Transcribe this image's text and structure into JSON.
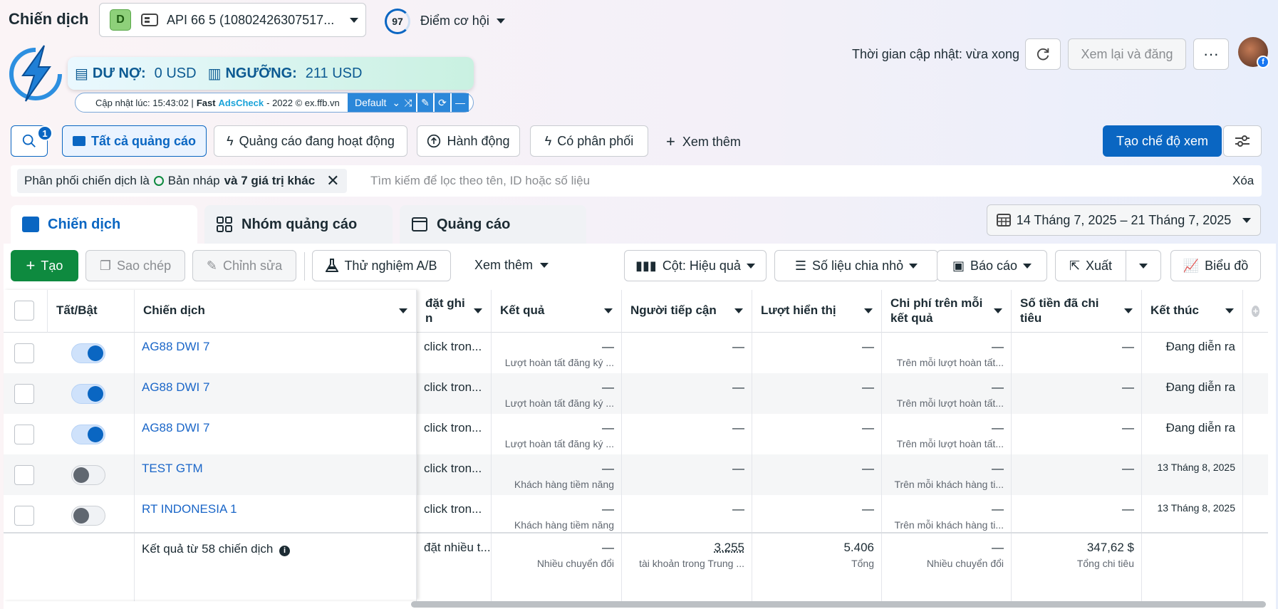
{
  "header": {
    "title": "Chiến dịch",
    "account_letter": "D",
    "account_name": "API 66 5 (10802426307517...",
    "opportunity_score": "97",
    "opportunity_label": "Điểm cơ hội",
    "update_time": "Thời gian cập nhật: vừa xong",
    "review_publish": "Xem lại và đăng",
    "more": "···"
  },
  "extension": {
    "debt_label": "DƯ NỢ:",
    "debt_value": "0 USD",
    "threshold_label": "NGƯỠNG:",
    "threshold_value": "211 USD",
    "updated_at": "Cập nhật lúc: 15:43:02 |",
    "brand_fast": "Fast",
    "brand_name": "AdsCheck",
    "copyright": "- 2022 © ex.ffb.vn",
    "profile": "Default"
  },
  "toolbar": {
    "search_badge": "1",
    "tab_all": "Tất cả quảng cáo",
    "tab_active": "Quảng cáo đang hoạt động",
    "tab_action": "Hành động",
    "tab_delivery": "Có phân phối",
    "see_more": "Xem thêm",
    "create_view": "Tạo chế độ xem"
  },
  "filter": {
    "prefix": "Phân phối chiến dịch là",
    "value": "Bản nháp",
    "suffix": "và 7 giá trị khác",
    "search_placeholder": "Tìm kiếm để lọc theo tên, ID hoặc số liệu",
    "clear": "Xóa"
  },
  "levels": {
    "campaign": "Chiến dịch",
    "adset": "Nhóm quảng cáo",
    "ad": "Quảng cáo"
  },
  "date_range": "14 Tháng 7, 2025 – 21 Tháng 7, 2025",
  "actions": {
    "create": "Tạo",
    "copy": "Sao chép",
    "edit": "Chỉnh sửa",
    "ab_test": "Thử nghiệm A/B",
    "more": "Xem thêm",
    "columns": "Cột: Hiệu quả",
    "breakdown": "Số liệu chia nhỏ",
    "reports": "Báo cáo",
    "export": "Xuất",
    "chart": "Biểu đồ"
  },
  "columns": {
    "toggle": "Tất/Bật",
    "campaign": "Chiến dịch",
    "attribution": "đặt ghi\nn",
    "results": "Kết quả",
    "reach": "Người tiếp cận",
    "impressions": "Lượt hiển thị",
    "cost_per_result": "Chi phí trên mỗi\nkết quả",
    "amount_spent": "Số tiền đã chi\ntiêu",
    "ends": "Kết thúc"
  },
  "rows": [
    {
      "name": "AG88 DWI 7",
      "on": true,
      "attribution": "click tron...",
      "result": "—",
      "result_sub": "Lượt hoàn tất đăng ký ...",
      "reach": "—",
      "impressions": "—",
      "cpr": "—",
      "cpr_sub": "Trên mỗi lượt hoàn tất...",
      "spent": "—",
      "ends": "Đang diễn ra"
    },
    {
      "name": "AG88 DWI 7",
      "on": true,
      "attribution": "click tron...",
      "result": "—",
      "result_sub": "Lượt hoàn tất đăng ký ...",
      "reach": "—",
      "impressions": "—",
      "cpr": "—",
      "cpr_sub": "Trên mỗi lượt hoàn tất...",
      "spent": "—",
      "ends": "Đang diễn ra"
    },
    {
      "name": "AG88 DWI 7",
      "on": true,
      "attribution": "click tron...",
      "result": "—",
      "result_sub": "Lượt hoàn tất đăng ký ...",
      "reach": "—",
      "impressions": "—",
      "cpr": "—",
      "cpr_sub": "Trên mỗi lượt hoàn tất...",
      "spent": "—",
      "ends": "Đang diễn ra"
    },
    {
      "name": "TEST GTM",
      "on": false,
      "attribution": "click tron...",
      "result": "—",
      "result_sub": "Khách hàng tiềm năng",
      "reach": "—",
      "impressions": "—",
      "cpr": "—",
      "cpr_sub": "Trên mỗi khách hàng ti...",
      "spent": "—",
      "ends": "13 Tháng 8, 2025"
    },
    {
      "name": "RT INDONESIA 1",
      "on": false,
      "attribution": "click tron...",
      "result": "—",
      "result_sub": "Khách hàng tiềm năng",
      "reach": "—",
      "impressions": "—",
      "cpr": "—",
      "cpr_sub": "Trên mỗi khách hàng ti...",
      "spent": "—",
      "ends": "13 Tháng 8, 2025"
    }
  ],
  "totals": {
    "label": "Kết quả từ 58 chiến dịch",
    "attribution": "đặt nhiều t...",
    "result": "—",
    "result_sub": "Nhiều chuyển đổi",
    "reach": "3.255",
    "reach_sub": "tài khoản trong Trung ...",
    "impressions": "5.406",
    "impressions_sub": "Tổng",
    "cpr": "—",
    "cpr_sub": "Nhiều chuyển đổi",
    "spent": "347,62 $",
    "spent_sub": "Tổng chi tiêu"
  }
}
